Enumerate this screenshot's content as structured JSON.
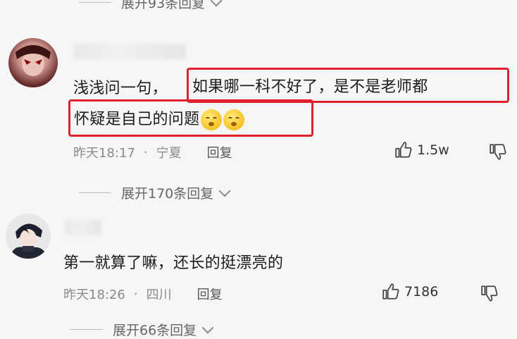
{
  "thread": {
    "top_expand": {
      "label": "展开93条回复"
    },
    "comments": [
      {
        "text_part1": "浅浅问一句，",
        "text_highlight_line1": "如果哪一科不好了，是不是老师都",
        "text_highlight_line2": "怀疑是自己的问题",
        "emojis": [
          "face-emoji",
          "face-emoji"
        ],
        "time": "昨天18:17",
        "location": "宁夏",
        "reply_label": "回复",
        "likes": "1.5w",
        "expand_label": "展开170条回复"
      },
      {
        "text": "第一就算了嘛，还长的挺漂亮的",
        "time": "昨天18:26",
        "location": "四川",
        "reply_label": "回复",
        "likes": "7186",
        "expand_label": "展开66条回复"
      }
    ],
    "meta_separator": "·"
  },
  "colors": {
    "highlight": "#e0222e",
    "meta": "#8a8a8a",
    "background": "#f6f6f6"
  },
  "icons": [
    "thumb-up-icon",
    "thumb-down-icon",
    "chevron-down-icon"
  ]
}
